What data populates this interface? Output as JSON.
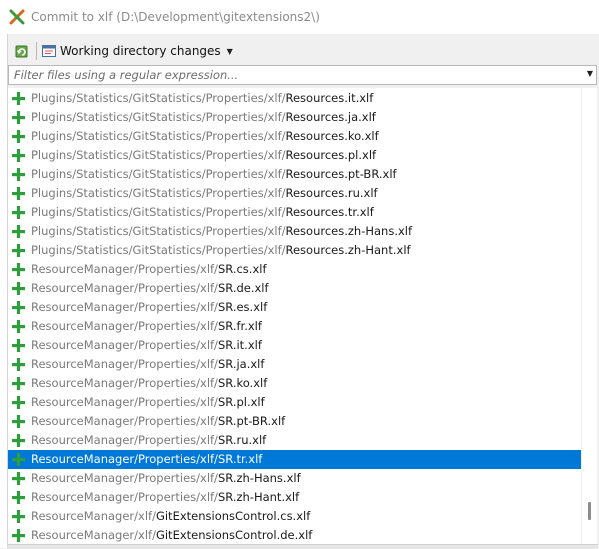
{
  "window": {
    "title": "Commit to xlf (D:\\Development\\gitextensions2\\)",
    "icon": "git-extensions-logo-icon"
  },
  "toolbar": {
    "refresh_icon": "refresh-icon",
    "changes_label": "Working directory changes",
    "changes_icon": "working-directory-icon"
  },
  "filter": {
    "placeholder": "Filter files using a regular expression...",
    "value": ""
  },
  "colors": {
    "selection": "#0078d7",
    "added": "#2e9e3a"
  },
  "files": [
    {
      "dir": "Plugins/Statistics/GitStatistics/Properties/xlf/",
      "name": "Resources.it.xlf",
      "status": "added",
      "selected": false
    },
    {
      "dir": "Plugins/Statistics/GitStatistics/Properties/xlf/",
      "name": "Resources.ja.xlf",
      "status": "added",
      "selected": false
    },
    {
      "dir": "Plugins/Statistics/GitStatistics/Properties/xlf/",
      "name": "Resources.ko.xlf",
      "status": "added",
      "selected": false
    },
    {
      "dir": "Plugins/Statistics/GitStatistics/Properties/xlf/",
      "name": "Resources.pl.xlf",
      "status": "added",
      "selected": false
    },
    {
      "dir": "Plugins/Statistics/GitStatistics/Properties/xlf/",
      "name": "Resources.pt-BR.xlf",
      "status": "added",
      "selected": false
    },
    {
      "dir": "Plugins/Statistics/GitStatistics/Properties/xlf/",
      "name": "Resources.ru.xlf",
      "status": "added",
      "selected": false
    },
    {
      "dir": "Plugins/Statistics/GitStatistics/Properties/xlf/",
      "name": "Resources.tr.xlf",
      "status": "added",
      "selected": false
    },
    {
      "dir": "Plugins/Statistics/GitStatistics/Properties/xlf/",
      "name": "Resources.zh-Hans.xlf",
      "status": "added",
      "selected": false
    },
    {
      "dir": "Plugins/Statistics/GitStatistics/Properties/xlf/",
      "name": "Resources.zh-Hant.xlf",
      "status": "added",
      "selected": false
    },
    {
      "dir": "ResourceManager/Properties/xlf/",
      "name": "SR.cs.xlf",
      "status": "added",
      "selected": false
    },
    {
      "dir": "ResourceManager/Properties/xlf/",
      "name": "SR.de.xlf",
      "status": "added",
      "selected": false
    },
    {
      "dir": "ResourceManager/Properties/xlf/",
      "name": "SR.es.xlf",
      "status": "added",
      "selected": false
    },
    {
      "dir": "ResourceManager/Properties/xlf/",
      "name": "SR.fr.xlf",
      "status": "added",
      "selected": false
    },
    {
      "dir": "ResourceManager/Properties/xlf/",
      "name": "SR.it.xlf",
      "status": "added",
      "selected": false
    },
    {
      "dir": "ResourceManager/Properties/xlf/",
      "name": "SR.ja.xlf",
      "status": "added",
      "selected": false
    },
    {
      "dir": "ResourceManager/Properties/xlf/",
      "name": "SR.ko.xlf",
      "status": "added",
      "selected": false
    },
    {
      "dir": "ResourceManager/Properties/xlf/",
      "name": "SR.pl.xlf",
      "status": "added",
      "selected": false
    },
    {
      "dir": "ResourceManager/Properties/xlf/",
      "name": "SR.pt-BR.xlf",
      "status": "added",
      "selected": false
    },
    {
      "dir": "ResourceManager/Properties/xlf/",
      "name": "SR.ru.xlf",
      "status": "added",
      "selected": false
    },
    {
      "dir": "ResourceManager/Properties/xlf/",
      "name": "SR.tr.xlf",
      "status": "added",
      "selected": true
    },
    {
      "dir": "ResourceManager/Properties/xlf/",
      "name": "SR.zh-Hans.xlf",
      "status": "added",
      "selected": false
    },
    {
      "dir": "ResourceManager/Properties/xlf/",
      "name": "SR.zh-Hant.xlf",
      "status": "added",
      "selected": false
    },
    {
      "dir": "ResourceManager/xlf/",
      "name": "GitExtensionsControl.cs.xlf",
      "status": "added",
      "selected": false
    },
    {
      "dir": "ResourceManager/xlf/",
      "name": "GitExtensionsControl.de.xlf",
      "status": "added",
      "selected": false
    }
  ]
}
